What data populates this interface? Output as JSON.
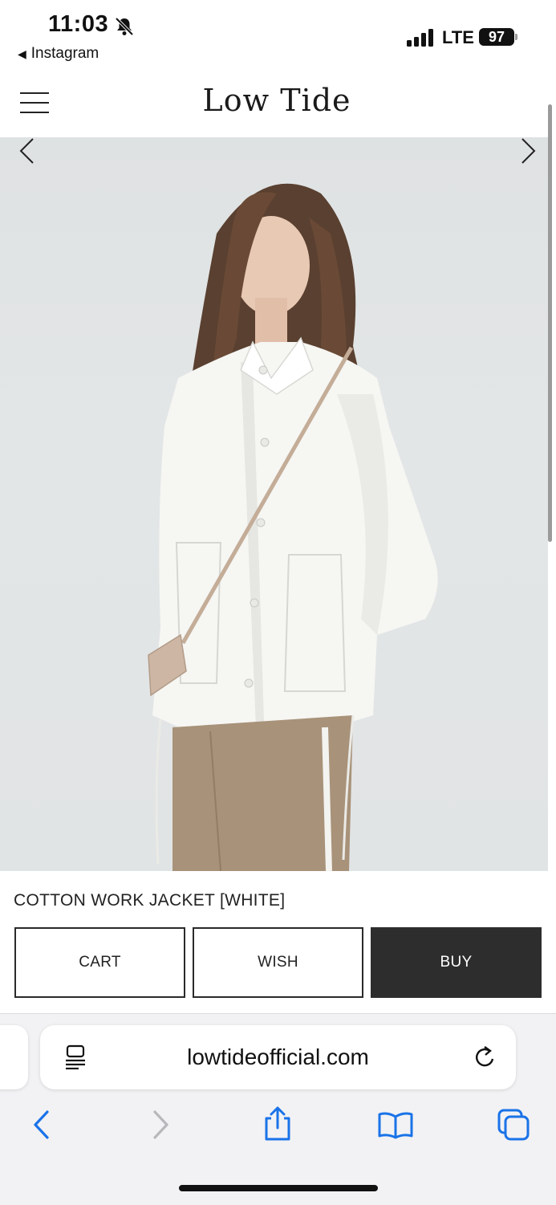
{
  "status_bar": {
    "time": "11:03",
    "back_app": "Instagram",
    "network": "LTE",
    "battery": "97"
  },
  "header": {
    "logo": "Low Tide"
  },
  "product": {
    "title": "COTTON WORK JACKET [WHITE]",
    "buttons": {
      "cart": "CART",
      "wish": "WISH",
      "buy": "BUY"
    }
  },
  "browser": {
    "url": "lowtideofficial.com"
  },
  "colors": {
    "buy_bg": "#2d2d2d",
    "safari_blue": "#1a73e8",
    "page_bg": "#ffffff"
  }
}
